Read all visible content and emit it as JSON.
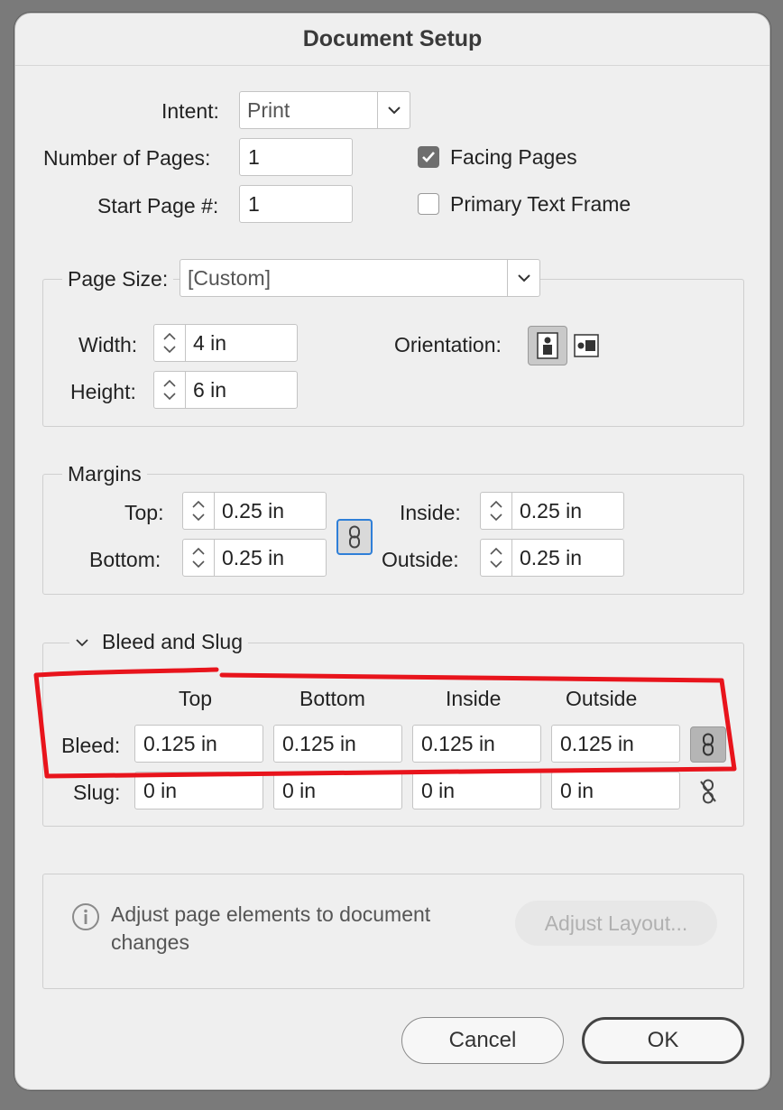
{
  "dialog": {
    "title": "Document Setup"
  },
  "top": {
    "intent_label": "Intent:",
    "intent_value": "Print",
    "pages_label": "Number of Pages:",
    "pages_value": "1",
    "start_label": "Start Page #:",
    "start_value": "1",
    "facing_label": "Facing Pages",
    "facing_checked": true,
    "primary_label": "Primary Text Frame",
    "primary_checked": false
  },
  "page_size": {
    "label": "Page Size:",
    "value": "[Custom]",
    "width_label": "Width:",
    "width_value": "4 in",
    "height_label": "Height:",
    "height_value": "6 in",
    "orientation_label": "Orientation:",
    "orientation_selected": "portrait"
  },
  "margins": {
    "legend": "Margins",
    "top_label": "Top:",
    "top_value": "0.25 in",
    "bottom_label": "Bottom:",
    "bottom_value": "0.25 in",
    "inside_label": "Inside:",
    "inside_value": "0.25 in",
    "outside_label": "Outside:",
    "outside_value": "0.25 in"
  },
  "bleed_slug": {
    "legend": "Bleed and Slug",
    "columns": [
      "Top",
      "Bottom",
      "Inside",
      "Outside"
    ],
    "bleed_label": "Bleed:",
    "bleed_values": [
      "0.125 in",
      "0.125 in",
      "0.125 in",
      "0.125 in"
    ],
    "slug_label": "Slug:",
    "slug_values": [
      "0 in",
      "0 in",
      "0 in",
      "0 in"
    ]
  },
  "adjust": {
    "info": "Adjust page elements to document changes",
    "info_line1": "Adjust page elements to document",
    "info_line2": "changes",
    "button": "Adjust Layout..."
  },
  "buttons": {
    "cancel": "Cancel",
    "ok": "OK"
  },
  "colors": {
    "annotation": "#e8141c",
    "dialog_bg": "#efefef",
    "link_active": "#2f7fd8"
  }
}
